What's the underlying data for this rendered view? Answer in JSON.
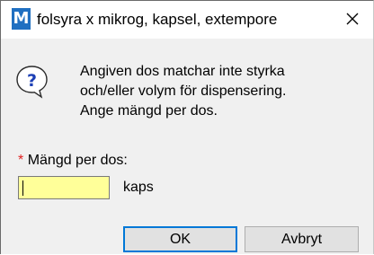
{
  "window": {
    "app_icon_letter": "M",
    "title": "folsyra x mikrog, kapsel, extempore",
    "close_icon": "close-icon"
  },
  "dialog": {
    "icon": "question-icon",
    "message_lines": [
      "Angiven dos matchar inte styrka",
      "och/eller volym för dispensering.",
      "Ange mängd per dos."
    ],
    "field_required_marker": "*",
    "field_label": "Mängd per dos:",
    "field_value": "",
    "field_unit": "kaps"
  },
  "buttons": {
    "ok_label": "OK",
    "cancel_label": "Avbryt"
  },
  "colors": {
    "app_icon_bg": "#1f6fc1",
    "input_bg": "#ffff99",
    "required_marker": "#e02020",
    "default_button_border": "#0078d7",
    "dialog_bg": "#f0f0f0"
  }
}
